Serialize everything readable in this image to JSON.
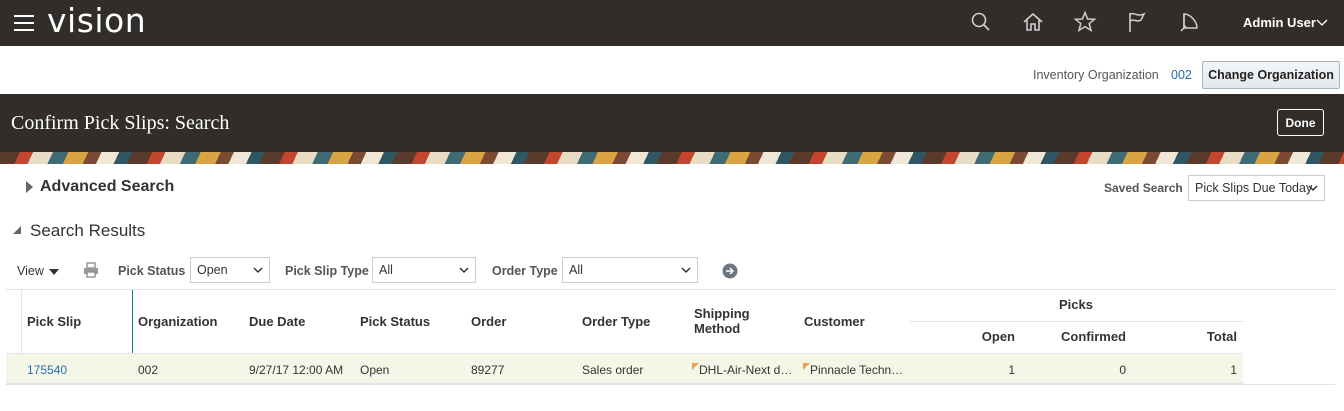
{
  "app": {
    "brand": "vision",
    "user": "Admin User",
    "icons": [
      "menu-icon",
      "search-icon",
      "home-icon",
      "favorites-star-icon",
      "flag-icon",
      "notifications-icon"
    ]
  },
  "org": {
    "label": "Inventory Organization",
    "value": "002",
    "change_button": "Change Organization"
  },
  "page": {
    "title": "Confirm Pick Slips: Search",
    "done_button": "Done"
  },
  "advanced_search": {
    "label": "Advanced Search",
    "saved_search_label": "Saved Search",
    "saved_search_value": "Pick Slips Due Today"
  },
  "results": {
    "title": "Search Results",
    "toolbar": {
      "view": "View",
      "pick_status_label": "Pick Status",
      "pick_status_value": "Open",
      "pick_slip_type_label": "Pick Slip Type",
      "pick_slip_type_value": "All",
      "order_type_label": "Order Type",
      "order_type_value": "All"
    },
    "columns": {
      "pick_slip": "Pick Slip",
      "organization": "Organization",
      "due_date": "Due Date",
      "pick_status": "Pick Status",
      "order": "Order",
      "order_type": "Order Type",
      "shipping_method_1": "Shipping",
      "shipping_method_2": "Method",
      "customer": "Customer",
      "picks": "Picks",
      "open": "Open",
      "confirmed": "Confirmed",
      "total": "Total"
    },
    "rows": [
      {
        "pick_slip": "175540",
        "organization": "002",
        "due_date": "9/27/17 12:00 AM",
        "pick_status": "Open",
        "order": "89277",
        "order_type": "Sales order",
        "shipping_method": "DHL-Air-Next d…",
        "customer": "Pinnacle Techn…",
        "open": "1",
        "confirmed": "0",
        "total": "1"
      }
    ]
  },
  "colors": {
    "header_bg": "#312d2a",
    "link": "#2b6cb0",
    "row_bg": "#f4f6e8",
    "accent_line": "#0f7d8a"
  }
}
